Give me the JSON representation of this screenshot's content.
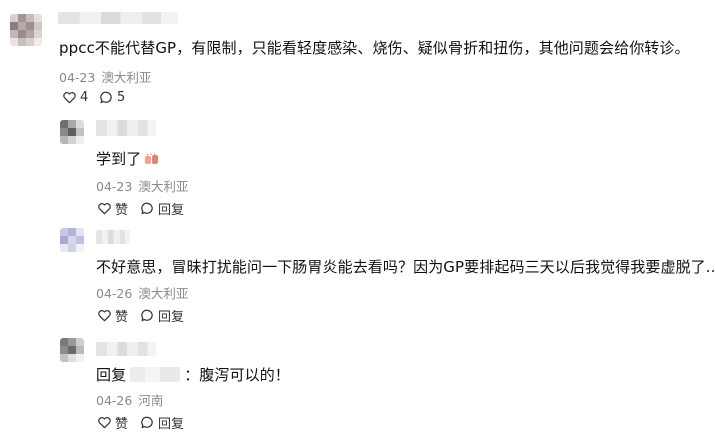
{
  "comment": {
    "text": "ppcc不能代替GP，有限制，只能看轻度感染、烧伤、疑似骨折和扭伤，其他问题会给你转诊。",
    "date": "04-23",
    "location": "澳大利亚",
    "like_count": "4",
    "reply_count": "5"
  },
  "replies": [
    {
      "text": "学到了",
      "date": "04-23",
      "location": "澳大利亚",
      "like_label": "赞",
      "reply_label": "回复"
    },
    {
      "text": "不好意思，冒昧打扰能问一下肠胃炎能去看吗？因为GP要排起码三天以后我觉得我要虚脱了....",
      "date": "04-26",
      "location": "澳大利亚",
      "like_label": "赞",
      "reply_label": "回复"
    },
    {
      "prefix": "回复",
      "text": "：腹泻可以的！",
      "date": "04-26",
      "location": "河南",
      "like_label": "赞",
      "reply_label": "回复"
    }
  ],
  "icons": {
    "like": "heart-icon",
    "reply": "speech-bubble-icon",
    "emoji": "clapping-hands-emoji"
  }
}
